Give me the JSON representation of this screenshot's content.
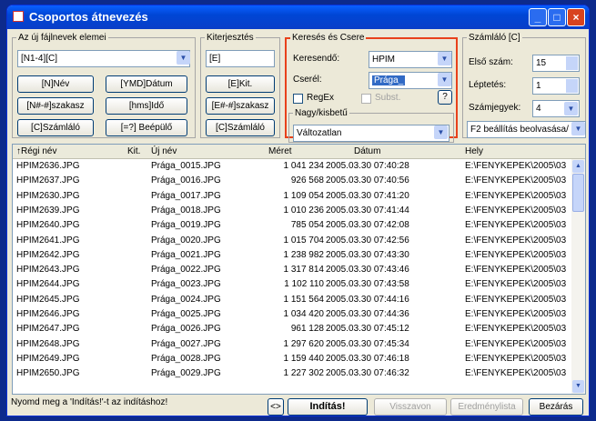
{
  "window": {
    "title": "Csoportos átnevezés",
    "minimize": "_",
    "maximize": "□",
    "close": "×"
  },
  "mask": {
    "legend": "Az új fájlnevek elemei",
    "value": "[N1-4][C]",
    "buttons": [
      "[N]Név",
      "[YMD]Dátum",
      "[N#-#]szakasz",
      "[hms]Idő",
      "[C]Számláló",
      "[=?] Beépülő"
    ]
  },
  "ext": {
    "legend": "Kiterjesztés",
    "value": "[E]",
    "buttons": [
      "[E]Kit.",
      "[E#-#]szakasz",
      "[C]Számláló"
    ]
  },
  "search": {
    "legend": "Keresés és Csere",
    "find_label": "Keresendő:",
    "find_value": "HPIM",
    "replace_label": "Cserél:",
    "replace_value": "Prága_",
    "regex_label": "RegEx",
    "subst_label": "Subst.",
    "help": "?"
  },
  "case": {
    "legend": "Nagy/kisbetű",
    "value": "Változatlan"
  },
  "counter": {
    "legend": "Számláló [C]",
    "start_label": "Első szám:",
    "start_value": "15",
    "step_label": "Léptetés:",
    "step_value": "1",
    "digits_label": "Számjegyek:",
    "digits_value": "4",
    "settings": "F2 beállítás beolvasása/"
  },
  "table": {
    "headers": [
      "↑Régi név",
      "Kit.",
      "Új név",
      "Méret",
      "Dátum",
      "Hely"
    ],
    "rows": [
      [
        "HPIM2636.JPG",
        "Prága_0015.JPG",
        "1 041 234",
        "2005.03.30 07:40:28",
        "E:\\FENYKEPEK\\2005\\03"
      ],
      [
        "HPIM2637.JPG",
        "Prága_0016.JPG",
        "926 568",
        "2005.03.30 07:40:56",
        "E:\\FENYKEPEK\\2005\\03"
      ],
      [
        "HPIM2630.JPG",
        "Prága_0017.JPG",
        "1 109 054",
        "2005.03.30 07:41:20",
        "E:\\FENYKEPEK\\2005\\03"
      ],
      [
        "HPIM2639.JPG",
        "Prága_0018.JPG",
        "1 010 236",
        "2005.03.30 07:41:44",
        "E:\\FENYKEPEK\\2005\\03"
      ],
      [
        "HPIM2640.JPG",
        "Prága_0019.JPG",
        "785 054",
        "2005.03.30 07:42:08",
        "E:\\FENYKEPEK\\2005\\03"
      ],
      [
        "HPIM2641.JPG",
        "Prága_0020.JPG",
        "1 015 704",
        "2005.03.30 07:42:56",
        "E:\\FENYKEPEK\\2005\\03"
      ],
      [
        "HPIM2642.JPG",
        "Prága_0021.JPG",
        "1 238 982",
        "2005.03.30 07:43:30",
        "E:\\FENYKEPEK\\2005\\03"
      ],
      [
        "HPIM2643.JPG",
        "Prága_0022.JPG",
        "1 317 814",
        "2005.03.30 07:43:46",
        "E:\\FENYKEPEK\\2005\\03"
      ],
      [
        "HPIM2644.JPG",
        "Prága_0023.JPG",
        "1 102 110",
        "2005.03.30 07:43:58",
        "E:\\FENYKEPEK\\2005\\03"
      ],
      [
        "HPIM2645.JPG",
        "Prága_0024.JPG",
        "1 151 564",
        "2005.03.30 07:44:16",
        "E:\\FENYKEPEK\\2005\\03"
      ],
      [
        "HPIM2646.JPG",
        "Prága_0025.JPG",
        "1 034 420",
        "2005.03.30 07:44:36",
        "E:\\FENYKEPEK\\2005\\03"
      ],
      [
        "HPIM2647.JPG",
        "Prága_0026.JPG",
        "961 128",
        "2005.03.30 07:45:12",
        "E:\\FENYKEPEK\\2005\\03"
      ],
      [
        "HPIM2648.JPG",
        "Prága_0027.JPG",
        "1 297 620",
        "2005.03.30 07:45:34",
        "E:\\FENYKEPEK\\2005\\03"
      ],
      [
        "HPIM2649.JPG",
        "Prága_0028.JPG",
        "1 159 440",
        "2005.03.30 07:46:18",
        "E:\\FENYKEPEK\\2005\\03"
      ],
      [
        "HPIM2650.JPG",
        "Prága_0029.JPG",
        "1 227 302",
        "2005.03.30 07:46:32",
        "E:\\FENYKEPEK\\2005\\03"
      ]
    ]
  },
  "footer": {
    "status": "Nyomd meg a 'Indítás!'-t az indításhoz!",
    "arrow": "<>",
    "start": "Indítás!",
    "undo": "Visszavon",
    "results": "Eredménylista",
    "close": "Bezárás"
  },
  "colors": {
    "highlight_border": "#e8411b",
    "title_bar": "#0a5fff"
  }
}
